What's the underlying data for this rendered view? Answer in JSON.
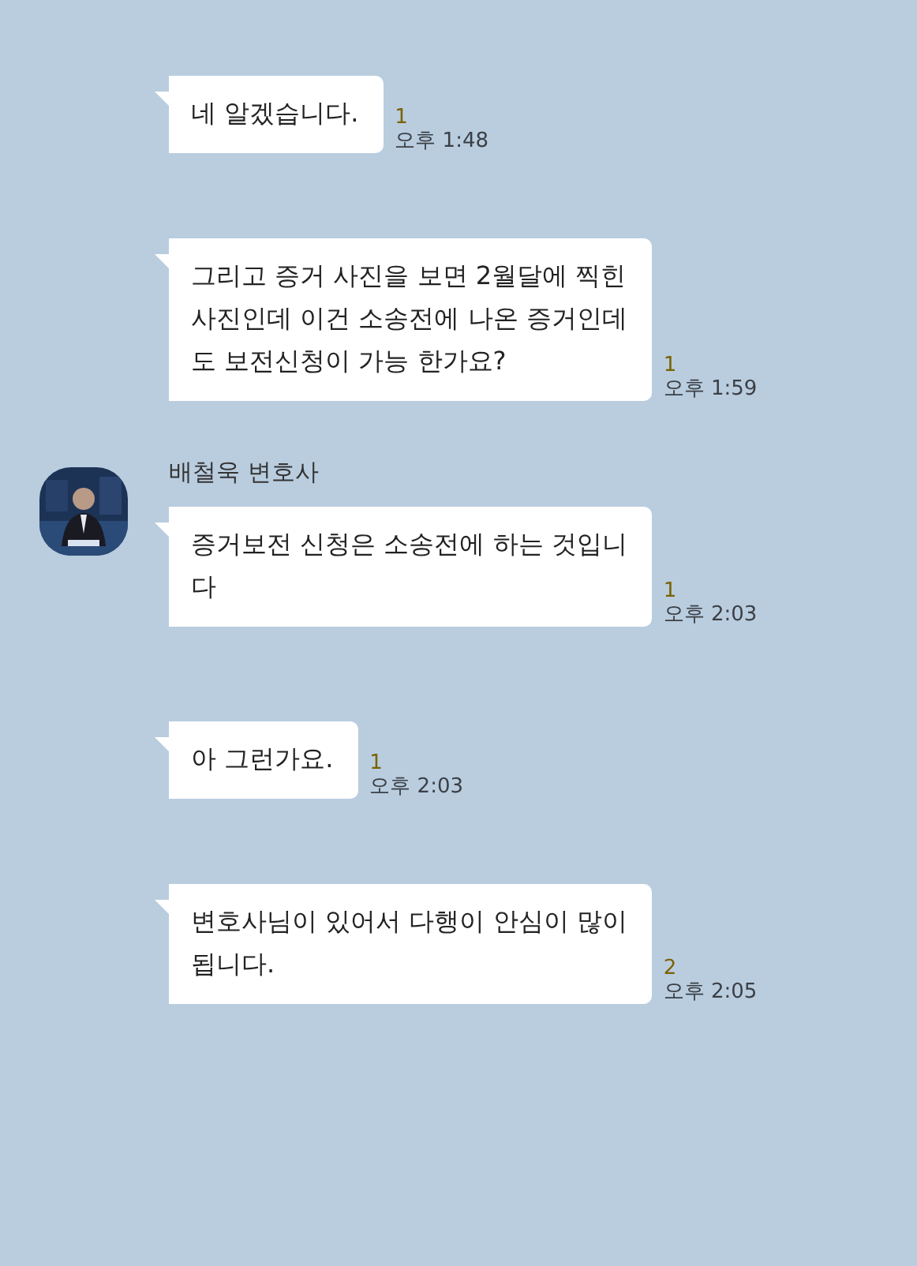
{
  "messages": [
    {
      "lines": [
        "네 알겠습니다."
      ],
      "unread": "1",
      "time": "오후 1:48"
    },
    {
      "lines": [
        "그리고 증거 사진을 보면 2월달에 찍힌",
        "사진인데 이건 소송전에 나온 증거인데",
        "도 보전신청이 가능 한가요?"
      ],
      "unread": "1",
      "time": "오후 1:59"
    },
    {
      "sender": "배철욱 변호사",
      "avatar": {
        "kind": "picture"
      },
      "lines": [
        "증거보전 신청은 소송전에 하는 것입니",
        "다"
      ],
      "unread": "1",
      "time": "오후 2:03"
    },
    {
      "lines": [
        "아 그런가요."
      ],
      "unread": "1",
      "time": "오후 2:03"
    },
    {
      "lines": [
        "변호사님이 있어서 다행이 안심이 많이",
        "됩니다."
      ],
      "unread": "2",
      "time": "오후 2:05"
    }
  ]
}
